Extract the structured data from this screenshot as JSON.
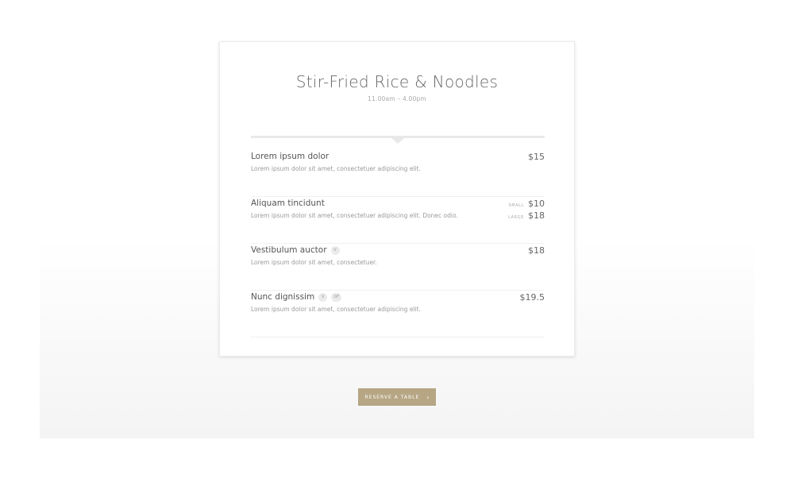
{
  "menu": {
    "title": "Stir-Fried Rice & Noodles",
    "hours": "11.00am – 4.00pm",
    "items": [
      {
        "name": "Lorem ipsum dolor",
        "description": "Lorem ipsum dolor sit amet, consectetuer adipiscing elit.",
        "price": "$15",
        "badges": []
      },
      {
        "name": "Aliquam tincidunt",
        "description": "Lorem ipsum dolor sit amet, consectetuer adipiscing elit. Donec odio.",
        "prices": [
          {
            "label": "SMALL",
            "price": "$10"
          },
          {
            "label": "LARGE",
            "price": "$18"
          }
        ],
        "badges": []
      },
      {
        "name": "Vestibulum auctor",
        "description": "Lorem ipsum dolor sit amet, consectetuer.",
        "price": "$18",
        "badges": [
          "V"
        ]
      },
      {
        "name": "Nunc dignissim",
        "description": "Lorem ipsum dolor sit amet, consectetuer adipiscing elit.",
        "price": "$19.5",
        "badges": [
          "V",
          "GF"
        ]
      }
    ]
  },
  "reserve_button": {
    "label": "RESERVE A TABLE",
    "icon": "chevron-right-icon"
  },
  "colors": {
    "accent": "#b6a684",
    "title": "#666666",
    "muted": "#9a9a9a"
  }
}
